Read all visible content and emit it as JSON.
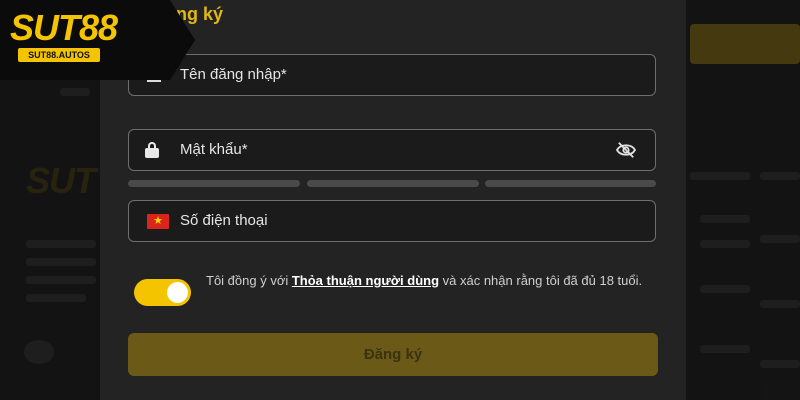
{
  "brand": {
    "logo_text": "SUT88",
    "logo_sub": "SUT88.AUTOS",
    "accent": "#f5c400"
  },
  "modal": {
    "title": "ng ký",
    "username_placeholder": "Tên đăng nhập*",
    "password_placeholder": "Mật khẩu*",
    "phone_placeholder": "Số điện thoại",
    "terms_prefix": "Tôi đồng ý với ",
    "terms_link": "Thỏa thuận người dùng",
    "terms_suffix": "  và xác nhận rằng tôi đã đủ 18 tuổi.",
    "agree_toggle_on": true,
    "submit_label": "Đăng ký"
  },
  "icons": {
    "username": "user-icon",
    "password": "lock-icon",
    "visibility": "eye-off-icon",
    "phone": "vietnam-flag-icon"
  }
}
